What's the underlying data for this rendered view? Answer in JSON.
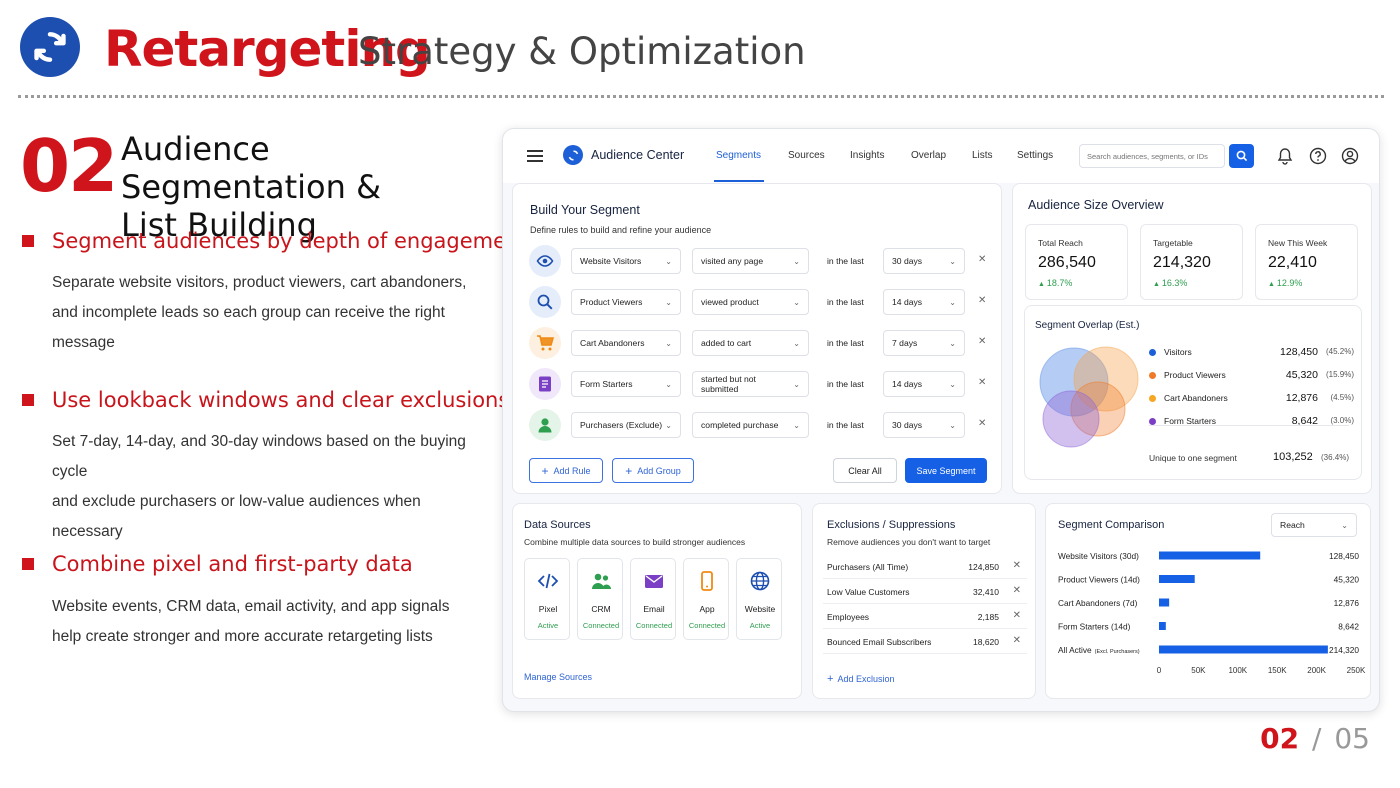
{
  "header": {
    "title": "Retargeting",
    "subtitle": "Strategy & Optimization",
    "logo_icon": "sync-icon",
    "brand_color": "#d0141b"
  },
  "section": {
    "number": "02",
    "title_line1": "Audience Segmentation &",
    "title_line2": "List Building"
  },
  "bullets": [
    {
      "heading": "Segment audiences by depth of engagement",
      "line1": "Separate website visitors, product viewers, cart abandoners,",
      "line2": "and incomplete leads so each group can receive the right message"
    },
    {
      "heading": "Use lookback windows and clear exclusions",
      "line1": "Set 7-day, 14-day, and 30-day windows based on the buying cycle",
      "line2": "and exclude purchasers or low-value audiences when necessary"
    },
    {
      "heading": "Combine pixel and first-party data",
      "line1": "Website events, CRM data, email activity, and app signals",
      "line2": "help create stronger and more accurate retargeting lists"
    }
  ],
  "app": {
    "name": "Audience Center",
    "nav": [
      "Segments",
      "Sources",
      "Insights",
      "Overlap",
      "Lists",
      "Settings"
    ],
    "active_nav": "Segments",
    "search_placeholder": "Search audiences, segments, or IDs",
    "accent": "#1660e6"
  },
  "builder": {
    "title": "Build Your Segment",
    "subtitle": "Define rules to build and refine your audience",
    "rules": [
      {
        "icon": "eye-icon",
        "color": "#1d4fb0",
        "bg": "#e6edfa",
        "audience": "Website Visitors",
        "action": "visited any page",
        "qualifier": "in the last",
        "window": "30 days"
      },
      {
        "icon": "search-icon",
        "color": "#1d4fb0",
        "bg": "#e6edfa",
        "audience": "Product Viewers",
        "action": "viewed product",
        "qualifier": "in the last",
        "window": "14 days"
      },
      {
        "icon": "cart-icon",
        "color": "#f08a14",
        "bg": "#fdf0e0",
        "audience": "Cart Abandoners",
        "action": "added to cart",
        "qualifier": "in the last",
        "window": "7 days"
      },
      {
        "icon": "form-icon",
        "color": "#7a3fc4",
        "bg": "#f0e8fa",
        "audience": "Form Starters",
        "action": "started but not submitted",
        "qualifier": "in the last",
        "window": "14 days"
      },
      {
        "icon": "user-icon",
        "color": "#2e9e4f",
        "bg": "#e5f4e9",
        "audience": "Purchasers (Exclude)",
        "action": "completed purchase",
        "qualifier": "in the last",
        "window": "30 days"
      }
    ],
    "add_rule": "Add Rule",
    "add_group": "Add Group",
    "clear_all": "Clear All",
    "save": "Save Segment"
  },
  "overview": {
    "title": "Audience Size Overview",
    "stats": [
      {
        "label": "Total Reach",
        "value": "286,540",
        "delta": "18.7%"
      },
      {
        "label": "Targetable",
        "value": "214,320",
        "delta": "16.3%"
      },
      {
        "label": "New This Week",
        "value": "22,410",
        "delta": "12.9%"
      }
    ],
    "overlap_title": "Segment Overlap (Est.)",
    "overlap": [
      {
        "name": "Visitors",
        "value": "128,450",
        "pct": "(45.2%)",
        "color": "#1d5fd6"
      },
      {
        "name": "Product Viewers",
        "value": "45,320",
        "pct": "(15.9%)",
        "color": "#f07a28"
      },
      {
        "name": "Cart Abandoners",
        "value": "12,876",
        "pct": "(4.5%)",
        "color": "#f5a623"
      },
      {
        "name": "Form Starters",
        "value": "8,642",
        "pct": "(3.0%)",
        "color": "#7a3fc4"
      }
    ],
    "unique_label": "Unique to one segment",
    "unique_value": "103,252",
    "unique_pct": "(36.4%)"
  },
  "sources": {
    "title": "Data Sources",
    "subtitle": "Combine multiple data sources to build stronger audiences",
    "items": [
      {
        "icon": "code-icon",
        "name": "Pixel",
        "status": "Active",
        "color": "#1d4fb0"
      },
      {
        "icon": "people-icon",
        "name": "CRM",
        "status": "Connected",
        "color": "#2e9e4f"
      },
      {
        "icon": "mail-icon",
        "name": "Email",
        "status": "Connected",
        "color": "#7a3fc4"
      },
      {
        "icon": "phone-icon",
        "name": "App",
        "status": "Connected",
        "color": "#f08a14"
      },
      {
        "icon": "globe-icon",
        "name": "Website",
        "status": "Active",
        "color": "#1d4fb0"
      }
    ],
    "manage": "Manage Sources"
  },
  "exclusions": {
    "title": "Exclusions / Suppressions",
    "subtitle": "Remove audiences you don't want to target",
    "items": [
      {
        "name": "Purchasers (All Time)",
        "value": "124,850"
      },
      {
        "name": "Low Value Customers",
        "value": "32,410"
      },
      {
        "name": "Employees",
        "value": "2,185"
      },
      {
        "name": "Bounced Email Subscribers",
        "value": "18,620"
      }
    ],
    "add": "Add Exclusion"
  },
  "chart_data": {
    "type": "bar",
    "title": "Segment Comparison",
    "dropdown": "Reach",
    "categories": [
      "Website Visitors (30d)",
      "Product Viewers (14d)",
      "Cart Abandoners (7d)",
      "Form Starters (14d)",
      "All Active"
    ],
    "category_note": "(Excl. Purchasers)",
    "values": [
      128450,
      45320,
      12876,
      8642,
      214320
    ],
    "value_labels": [
      "128,450",
      "45,320",
      "12,876",
      "8,642",
      "214,320"
    ],
    "xlim": [
      0,
      250000
    ],
    "ticks": [
      "0",
      "50K",
      "100K",
      "150K",
      "200K",
      "250K"
    ],
    "bar_color": "#1660e6"
  },
  "pager": {
    "current": "02",
    "sep": "/",
    "total": "05"
  }
}
